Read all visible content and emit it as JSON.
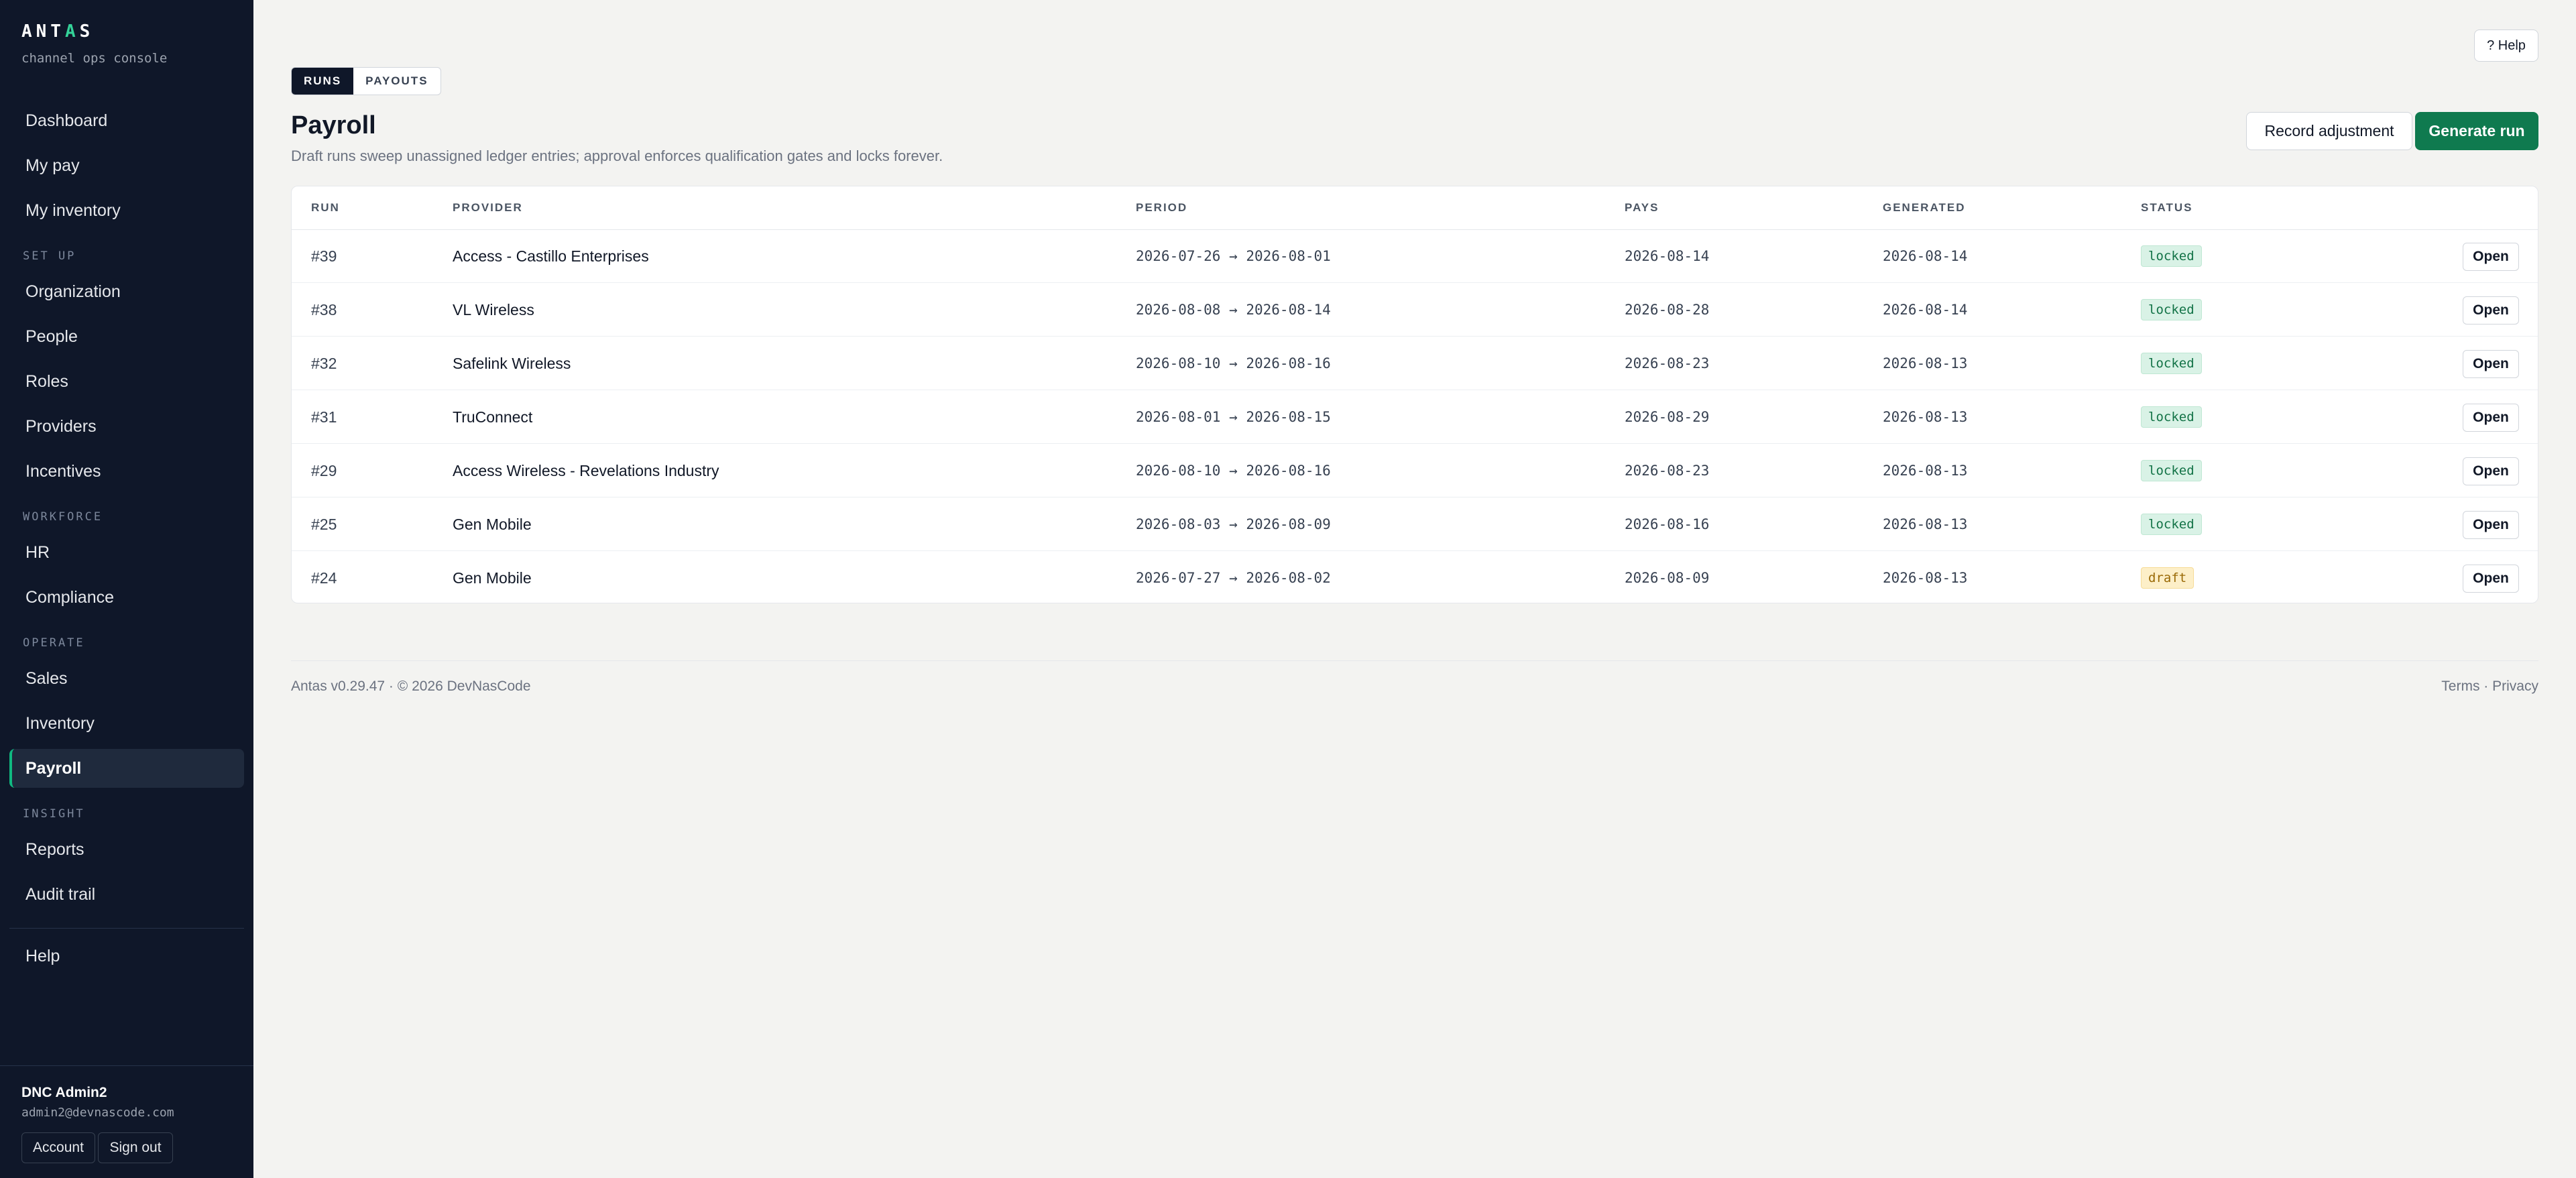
{
  "brand": {
    "name_pre": "ANT",
    "name_accent": "A",
    "name_post": "S",
    "tagline": "channel ops console"
  },
  "nav": {
    "items": [
      {
        "label": "Dashboard"
      },
      {
        "label": "My pay"
      },
      {
        "label": "My inventory"
      }
    ],
    "sections": [
      {
        "title": "SET UP",
        "items": [
          {
            "label": "Organization"
          },
          {
            "label": "People"
          },
          {
            "label": "Roles"
          },
          {
            "label": "Providers"
          },
          {
            "label": "Incentives"
          }
        ]
      },
      {
        "title": "WORKFORCE",
        "items": [
          {
            "label": "HR"
          },
          {
            "label": "Compliance"
          }
        ]
      },
      {
        "title": "OPERATE",
        "items": [
          {
            "label": "Sales"
          },
          {
            "label": "Inventory"
          },
          {
            "label": "Payroll"
          }
        ]
      },
      {
        "title": "INSIGHT",
        "items": [
          {
            "label": "Reports"
          },
          {
            "label": "Audit trail"
          }
        ]
      }
    ],
    "help": "Help"
  },
  "user": {
    "name": "DNC Admin2",
    "email": "admin2@devnascode.com",
    "account": "Account",
    "sign_out": "Sign out"
  },
  "header": {
    "help": "? Help",
    "tabs": [
      {
        "label": "RUNS"
      },
      {
        "label": "PAYOUTS"
      }
    ],
    "title": "Payroll",
    "subtitle": "Draft runs sweep unassigned ledger entries; approval enforces qualification gates and locks forever.",
    "record_adjustment": "Record adjustment",
    "generate_run": "Generate run"
  },
  "table": {
    "columns": [
      "RUN",
      "PROVIDER",
      "PERIOD",
      "PAYS",
      "GENERATED",
      "STATUS"
    ],
    "open_label": "Open",
    "rows": [
      {
        "run": "#39",
        "provider": "Access - Castillo Enterprises",
        "period": "2026-07-26 → 2026-08-01",
        "pays": "2026-08-14",
        "generated": "2026-08-14",
        "status": "locked"
      },
      {
        "run": "#38",
        "provider": "VL Wireless",
        "period": "2026-08-08 → 2026-08-14",
        "pays": "2026-08-28",
        "generated": "2026-08-14",
        "status": "locked"
      },
      {
        "run": "#32",
        "provider": "Safelink Wireless",
        "period": "2026-08-10 → 2026-08-16",
        "pays": "2026-08-23",
        "generated": "2026-08-13",
        "status": "locked"
      },
      {
        "run": "#31",
        "provider": "TruConnect",
        "period": "2026-08-01 → 2026-08-15",
        "pays": "2026-08-29",
        "generated": "2026-08-13",
        "status": "locked"
      },
      {
        "run": "#29",
        "provider": "Access Wireless - Revelations Industry",
        "period": "2026-08-10 → 2026-08-16",
        "pays": "2026-08-23",
        "generated": "2026-08-13",
        "status": "locked"
      },
      {
        "run": "#25",
        "provider": "Gen Mobile",
        "period": "2026-08-03 → 2026-08-09",
        "pays": "2026-08-16",
        "generated": "2026-08-13",
        "status": "locked"
      },
      {
        "run": "#24",
        "provider": "Gen Mobile",
        "period": "2026-07-27 → 2026-08-02",
        "pays": "2026-08-09",
        "generated": "2026-08-13",
        "status": "draft"
      }
    ]
  },
  "footer": {
    "left": "Antas v0.29.47 · © 2026 DevNasCode",
    "terms": "Terms",
    "separator": " · ",
    "privacy": "Privacy"
  },
  "colors": {
    "sidebar_bg": "#0f1729",
    "accent": "#10b981",
    "primary_button": "#0f7a4f",
    "locked_badge": "#d9f2e6",
    "draft_badge": "#fdefc8"
  }
}
